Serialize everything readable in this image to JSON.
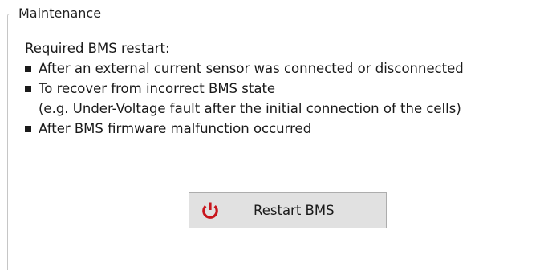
{
  "groupbox": {
    "title": "Maintenance"
  },
  "content": {
    "intro": "Required BMS restart:",
    "bullets": [
      {
        "lines": [
          "After an external current sensor was connected or disconnected"
        ]
      },
      {
        "lines": [
          "To recover from incorrect BMS state",
          "(e.g. Under-Voltage fault after the initial connection of the cells)"
        ]
      },
      {
        "lines": [
          "After BMS firmware malfunction occurred"
        ]
      }
    ]
  },
  "restart_button": {
    "label": "Restart BMS",
    "icon": "power-icon",
    "icon_color": "#c8161d"
  }
}
